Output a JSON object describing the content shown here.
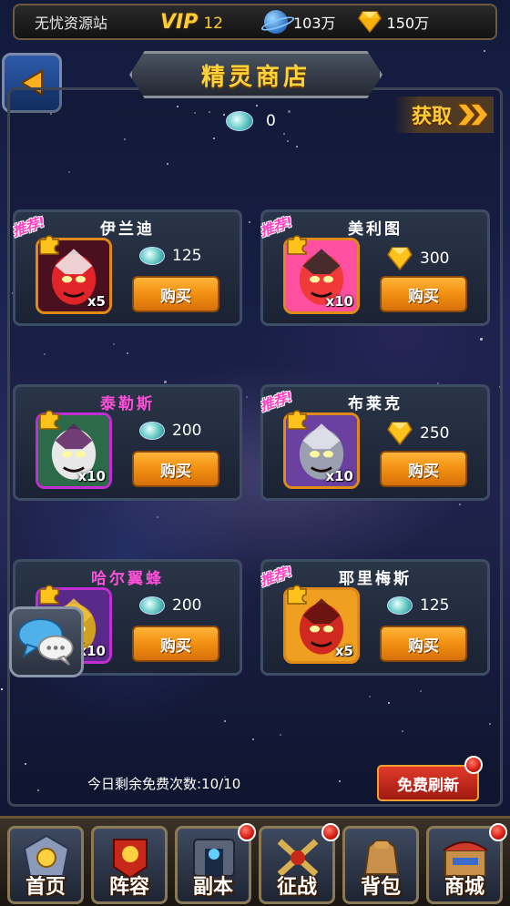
{
  "topbar": {
    "site_name": "无忧资源站",
    "vip_label": "VIP",
    "vip_level": "12",
    "resources": [
      {
        "icon": "planet-icon",
        "value": "103万"
      },
      {
        "icon": "diamond-icon",
        "value": "150万"
      }
    ]
  },
  "header": {
    "title": "精灵商店",
    "currency_value": "0",
    "obtain_label": "获取"
  },
  "shop": {
    "items": [
      {
        "name": "伊兰迪",
        "name_color": "#ffffff",
        "quantity": "x5",
        "price": "125",
        "currency": "crystal",
        "recommended": true,
        "recommend_label": "推荐!",
        "buy_label": "购买"
      },
      {
        "name": "美利图",
        "name_color": "#ffffff",
        "quantity": "x10",
        "price": "300",
        "currency": "diamond",
        "recommended": true,
        "recommend_label": "推荐!",
        "buy_label": "购买"
      },
      {
        "name": "泰勒斯",
        "name_color": "#ff4fd8",
        "quantity": "x10",
        "price": "200",
        "currency": "crystal",
        "recommended": false,
        "buy_label": "购买"
      },
      {
        "name": "布莱克",
        "name_color": "#ffffff",
        "quantity": "x10",
        "price": "250",
        "currency": "diamond",
        "recommended": true,
        "recommend_label": "推荐!",
        "buy_label": "购买"
      },
      {
        "name": "哈尔翼蜂",
        "name_color": "#ff4fd8",
        "quantity": "x10",
        "price": "200",
        "currency": "crystal",
        "recommended": false,
        "buy_label": "购买"
      },
      {
        "name": "耶里梅斯",
        "name_color": "#ffffff",
        "quantity": "x5",
        "price": "125",
        "currency": "crystal",
        "recommended": true,
        "recommend_label": "推荐!",
        "buy_label": "购买"
      }
    ]
  },
  "footer": {
    "free_refresh_text": "今日剩余免费次数:10/10",
    "refresh_label": "免费刷新"
  },
  "nav": {
    "items": [
      {
        "label": "首页",
        "icon": "home-icon",
        "badge": false
      },
      {
        "label": "阵容",
        "icon": "lineup-icon",
        "badge": false
      },
      {
        "label": "副本",
        "icon": "dungeon-icon",
        "badge": true
      },
      {
        "label": "征战",
        "icon": "battle-icon",
        "badge": true
      },
      {
        "label": "背包",
        "icon": "backpack-icon",
        "badge": false
      },
      {
        "label": "商城",
        "icon": "store-icon",
        "badge": true
      }
    ]
  },
  "colors": {
    "gold": "#ffcc33",
    "buy_button": "#f08f10",
    "refresh_button": "#c8281a",
    "recommend_tag": "#ff3ec8"
  }
}
